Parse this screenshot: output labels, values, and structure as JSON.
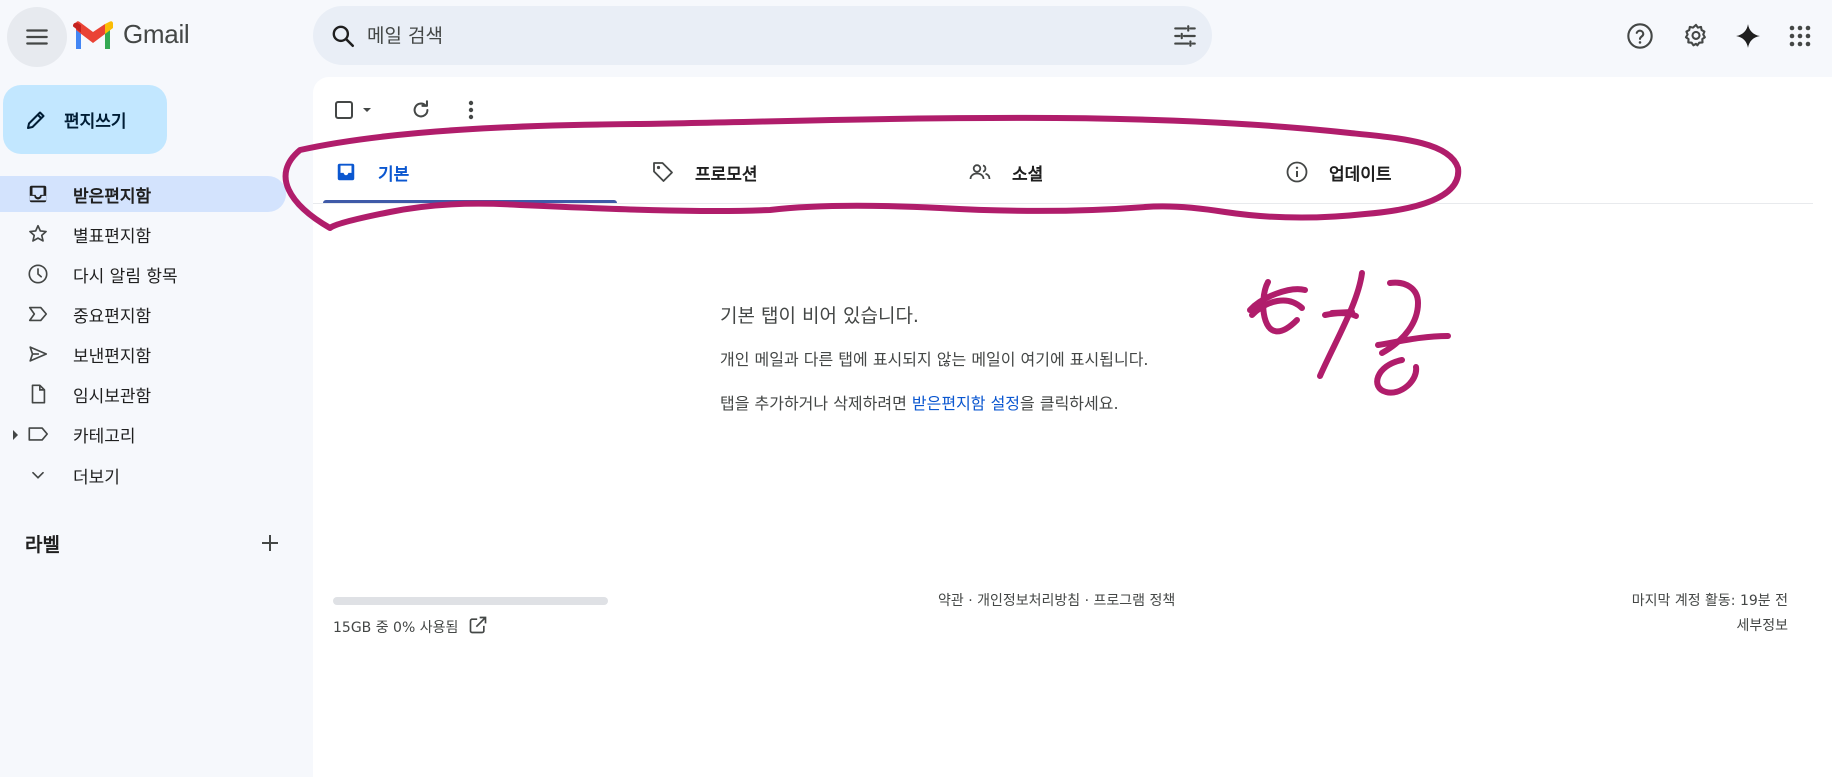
{
  "header": {
    "app_name": "Gmail",
    "search_placeholder": "메일 검색",
    "icons": [
      "menu-icon",
      "gmail-logo",
      "search-icon",
      "filter-icon",
      "help-icon",
      "gear-icon",
      "sparkle-icon",
      "apps-icon"
    ]
  },
  "sidebar": {
    "compose_label": "편지쓰기",
    "items": [
      {
        "label": "받은편지함",
        "icon": "inbox-icon",
        "active": true
      },
      {
        "label": "별표편지함",
        "icon": "star-icon"
      },
      {
        "label": "다시 알림 항목",
        "icon": "clock-icon"
      },
      {
        "label": "중요편지함",
        "icon": "important-icon"
      },
      {
        "label": "보낸편지함",
        "icon": "send-icon"
      },
      {
        "label": "임시보관함",
        "icon": "draft-icon"
      },
      {
        "label": "카테고리",
        "icon": "label-icon"
      },
      {
        "label": "더보기",
        "icon": "chevron-down-icon"
      }
    ],
    "labels_title": "라벨"
  },
  "tabs": [
    {
      "label": "기본",
      "icon": "inbox-icon",
      "active": true
    },
    {
      "label": "프로모션",
      "icon": "tag-icon"
    },
    {
      "label": "소셜",
      "icon": "people-icon"
    },
    {
      "label": "업데이트",
      "icon": "info-icon"
    }
  ],
  "empty_state": {
    "title": "기본 탭이 비어 있습니다.",
    "description": "개인 메일과 다른 탭에 표시되지 않는 메일이 여기에 표시됩니다.",
    "instruction_prefix": "탭을 추가하거나 삭제하려면 ",
    "instruction_link": "받은편지함 설정",
    "instruction_suffix": "을 클릭하세요."
  },
  "footer": {
    "storage_text": "15GB 중 0% 사용됨",
    "storage_used_fraction": 0,
    "terms": "약관",
    "privacy": "개인정보처리방침",
    "program_policy": "프로그램 정책",
    "separator": " · ",
    "last_activity": "마지막 계정 활동: 19분 전",
    "details": "세부정보"
  },
  "annotation": {
    "handwritten_text": "성공",
    "color": "#b01d6b"
  },
  "colors": {
    "background": "#f6f8fc",
    "accent": "#0b57d0",
    "compose_bg": "#c2e7ff",
    "active_nav": "#d3e3fd"
  }
}
